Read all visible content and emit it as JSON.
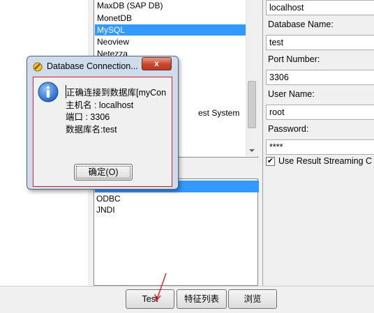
{
  "driver_list": {
    "items": [
      "MaxDB (SAP DB)",
      "MonetDB",
      "MySQL",
      "Neoview",
      "Netezza"
    ],
    "selected": "MySQL",
    "partial_item": "est System"
  },
  "access_list": {
    "items": [
      "ODBC",
      "JNDI"
    ]
  },
  "form": {
    "host_value": "localhost",
    "database_label": "Database Name:",
    "database_value": "test",
    "port_label": "Port Number:",
    "port_value": "3306",
    "user_label": "User Name:",
    "user_value": "root",
    "password_label": "Password:",
    "password_value": "****",
    "streaming_checked": "✔",
    "streaming_label": "Use Result Streaming C"
  },
  "buttons": {
    "test": "Test",
    "feature_list": "特征列表",
    "browse": "浏览"
  },
  "message_box": {
    "title": "Database Connection...",
    "close": "x",
    "line1": "正确连接到数据库[myCon",
    "line2": "主机名       : localhost",
    "line3": "端口          : 3306",
    "line4": "数据库名:test",
    "ok": "确定(O)"
  },
  "colors": {
    "selection": "#3399ff",
    "annotation_arrow": "#e02020",
    "info_icon": "#1f5fbf"
  }
}
